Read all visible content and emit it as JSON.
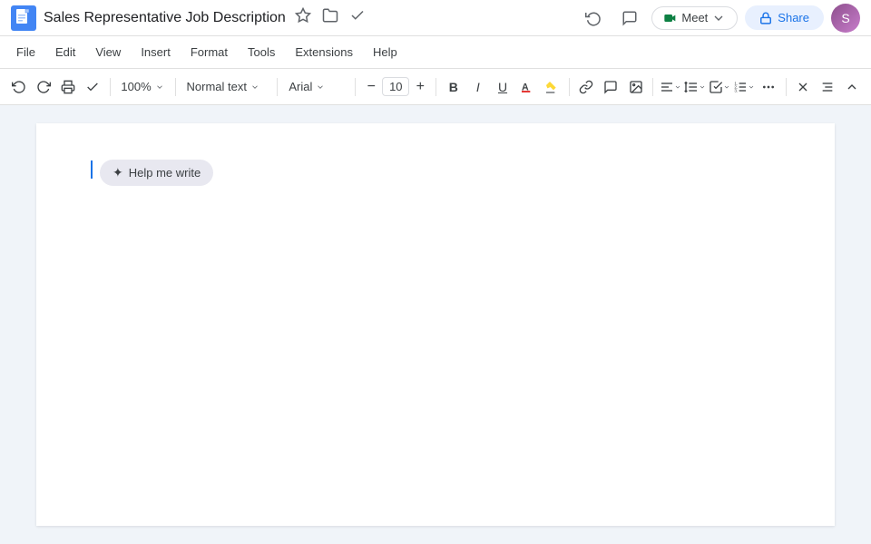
{
  "title_bar": {
    "doc_title": "Sales Representative Job Description",
    "star_label": "⭐",
    "history_label": "⟳",
    "cloud_label": "☁",
    "history_icon": "history",
    "comment_icon": "comment",
    "meet_label": "Meet",
    "share_label": "Share",
    "lock_icon": "🔒"
  },
  "menu": {
    "items": [
      "File",
      "Edit",
      "View",
      "Insert",
      "Format",
      "Tools",
      "Extensions",
      "Help"
    ]
  },
  "toolbar": {
    "undo_label": "↩",
    "redo_label": "↪",
    "print_label": "🖨",
    "spell_label": "✓",
    "zoom_value": "100%",
    "style_value": "Normal text",
    "font_value": "Arial",
    "font_size_value": "10",
    "bold_label": "B",
    "italic_label": "I",
    "underline_label": "U",
    "text_color_label": "A",
    "highlight_label": "▓",
    "link_label": "🔗",
    "comment_label": "💬",
    "image_label": "🖼",
    "align_label": "≡",
    "spacing_label": "↕",
    "list_label": "☰",
    "numbered_label": "№",
    "more_label": "…",
    "clear_label": "✕",
    "format_label": "A",
    "expand_label": "∧"
  },
  "document": {
    "help_me_write_label": "Help me write",
    "sparkle_icon": "✦"
  }
}
